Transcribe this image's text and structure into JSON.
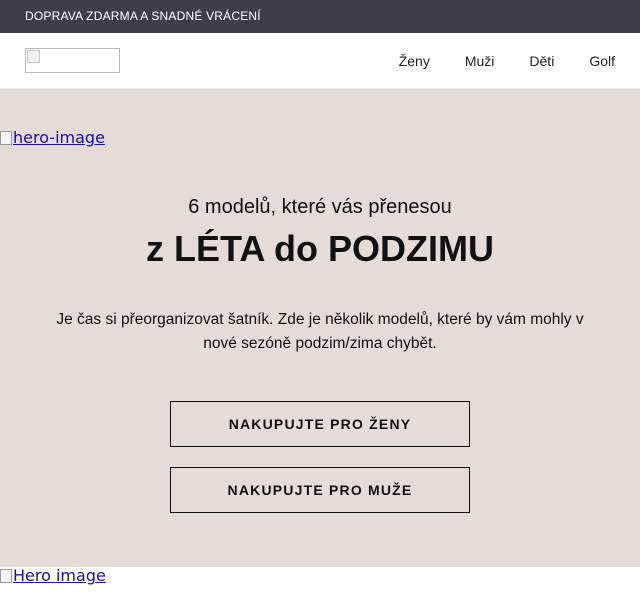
{
  "topbar": {
    "text": "DOPRAVA ZDARMA A SNADNÉ VRÁCENÍ"
  },
  "nav": {
    "logo_alt": "",
    "items": [
      {
        "label": "Ženy"
      },
      {
        "label": "Muži"
      },
      {
        "label": "Děti"
      },
      {
        "label": "Golf"
      }
    ]
  },
  "hero": {
    "image_alt": "hero-image",
    "pre_title": "6 modelů, které vás přenesou",
    "title": "z LÉTA do PODZIMU",
    "description": "Je čas si přeorganizovat šatník. Zde je několik modelů, které by vám mohly v nové sezóně podzim/zima chybět.",
    "buttons": [
      {
        "label": "NAKUPUJTE PRO ŽENY"
      },
      {
        "label": "NAKUPUJTE PRO MUŽE"
      }
    ],
    "background": "#e5dcd7"
  },
  "bottom_image": {
    "alt": "Hero image"
  },
  "colors": {
    "topbar": "#3c3f4a",
    "link": "#1a0dab"
  }
}
